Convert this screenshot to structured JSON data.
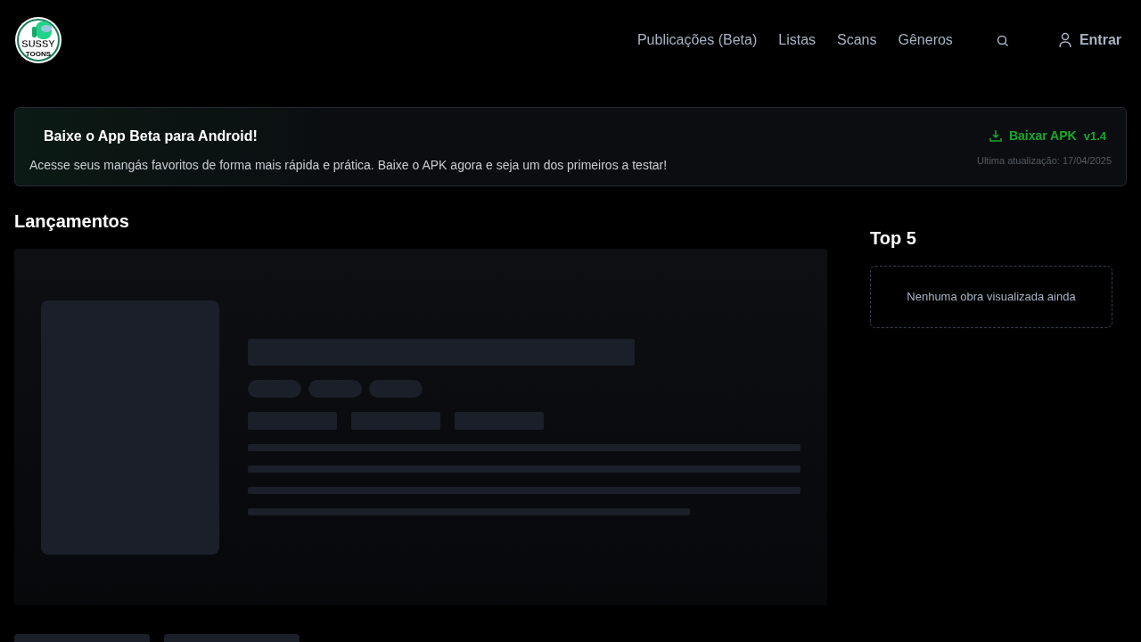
{
  "logo": {
    "lines": [
      "SUSSY",
      "TOONS"
    ]
  },
  "nav": {
    "links": [
      "Publicações (Beta)",
      "Listas",
      "Scans",
      "Gêneros"
    ],
    "login": "Entrar"
  },
  "banner": {
    "title": "Baixe o App Beta para Android!",
    "text": "Acesse seus mangás favoritos de forma mais rápida e prática. Baixe o APK agora e seja um dos primeiros a testar!",
    "button": "Baixar APK",
    "version": "v1.4",
    "updated": "Ultima atualização: 17/04/2025"
  },
  "releases": {
    "title": "Lançamentos",
    "loading": true
  },
  "top": {
    "title": "Top 5",
    "empty": "Nenhuma obra visualizada ainda"
  }
}
